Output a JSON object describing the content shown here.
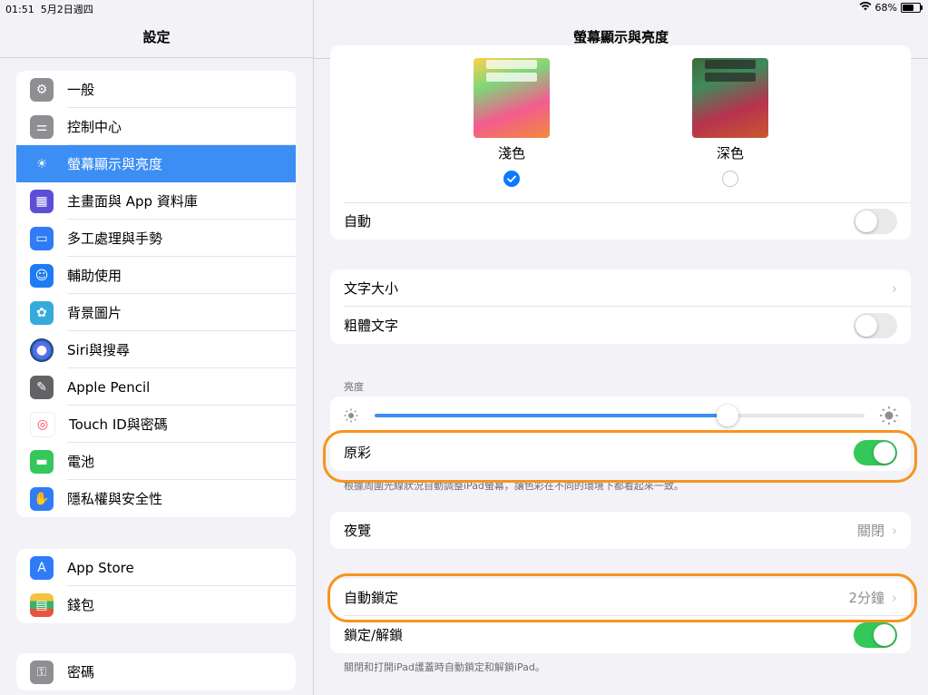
{
  "status_bar": {
    "time": "01:51",
    "date": "5月2日週四",
    "battery": "68%",
    "battery_level": 0.68
  },
  "sidebar": {
    "title": "設定",
    "groups": [
      [
        {
          "label": "一般",
          "icon": "gear-icon",
          "color": "#8e8e93",
          "active": false
        },
        {
          "label": "控制中心",
          "icon": "switches-icon",
          "color": "#8e8e93",
          "active": false
        },
        {
          "label": "螢幕顯示與亮度",
          "icon": "sun-icon",
          "color": "#3c8ef4",
          "active": true
        },
        {
          "label": "主畫面與 App 資料庫",
          "icon": "grid-icon",
          "color": "#5b4fd6",
          "active": false
        },
        {
          "label": "多工處理與手勢",
          "icon": "multitask-icon",
          "color": "#2f7cf6",
          "active": false
        },
        {
          "label": "輔助使用",
          "icon": "accessibility-icon",
          "color": "#1e7cf2",
          "active": false
        },
        {
          "label": "背景圖片",
          "icon": "flower-icon",
          "color": "#35aadc",
          "active": false
        },
        {
          "label": "Siri與搜尋",
          "icon": "siri-icon",
          "color": "#222",
          "active": false
        },
        {
          "label": "Apple Pencil",
          "icon": "pencil-icon",
          "color": "#636366",
          "active": false
        },
        {
          "label": "Touch ID與密碼",
          "icon": "fingerprint-icon",
          "color": "#ffffff",
          "active": false
        },
        {
          "label": "電池",
          "icon": "battery-icon",
          "color": "#34c759",
          "active": false
        },
        {
          "label": "隱私權與安全性",
          "icon": "hand-icon",
          "color": "#2f7cf6",
          "active": false
        }
      ],
      [
        {
          "label": "App Store",
          "icon": "appstore-icon",
          "color": "#2f7cf6",
          "active": false
        },
        {
          "label": "錢包",
          "icon": "wallet-icon",
          "color": "#222",
          "active": false
        }
      ],
      [
        {
          "label": "密碼",
          "icon": "key-icon",
          "color": "#8e8e93",
          "active": false
        }
      ]
    ]
  },
  "main": {
    "title": "螢幕顯示與亮度",
    "appearance": {
      "light_label": "淺色",
      "dark_label": "深色",
      "selected": "light",
      "auto_label": "自動",
      "auto_on": false
    },
    "text": {
      "size_label": "文字大小",
      "bold_label": "粗體文字",
      "bold_on": false
    },
    "brightness": {
      "section_label": "亮度",
      "level": 0.72,
      "true_tone_label": "原彩",
      "true_tone_on": true,
      "true_tone_note": "根據周圍光線狀況自動調整iPad螢幕，讓色彩在不同的環境下都看起來一致。"
    },
    "night_shift": {
      "label": "夜覽",
      "value": "關閉"
    },
    "lock": {
      "auto_lock_label": "自動鎖定",
      "auto_lock_value": "2分鐘",
      "lock_unlock_label": "鎖定/解鎖",
      "lock_unlock_on": true,
      "note": "關閉和打開iPad護蓋時自動鎖定和解鎖iPad。"
    },
    "accent_color": "#f7941d"
  }
}
